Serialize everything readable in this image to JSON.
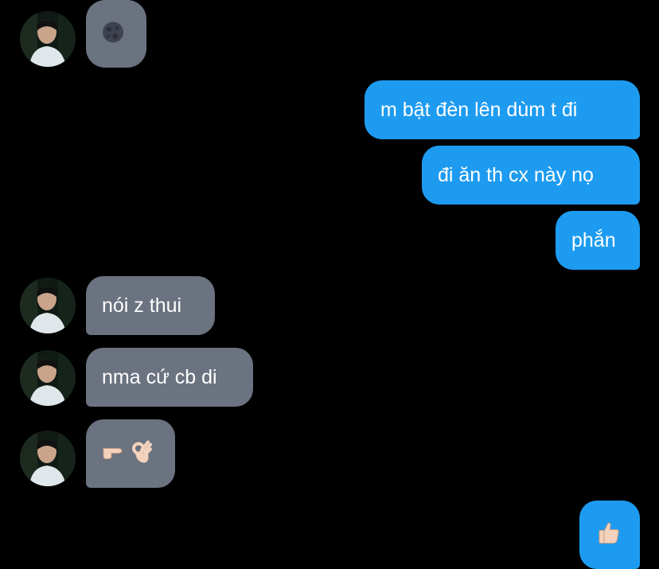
{
  "messages": [
    {
      "sender": "other",
      "emoji": "moon-emoji"
    },
    {
      "sender": "me",
      "text": "m bật đèn lên dùm t đi"
    },
    {
      "sender": "me",
      "text": "đi ăn th cx này nọ"
    },
    {
      "sender": "me",
      "text": "phắn"
    },
    {
      "sender": "other",
      "text": "nói z thui"
    },
    {
      "sender": "other",
      "text": "nma cứ cb di"
    },
    {
      "sender": "other",
      "emoji": "pointing-and-ok-emoji"
    },
    {
      "sender": "me",
      "emoji": "thumbs-up-emoji"
    }
  ],
  "colors": {
    "background": "#000000",
    "incoming_bubble": "#6b7280",
    "outgoing_bubble": "#1d9bf0",
    "text": "#ffffff"
  }
}
